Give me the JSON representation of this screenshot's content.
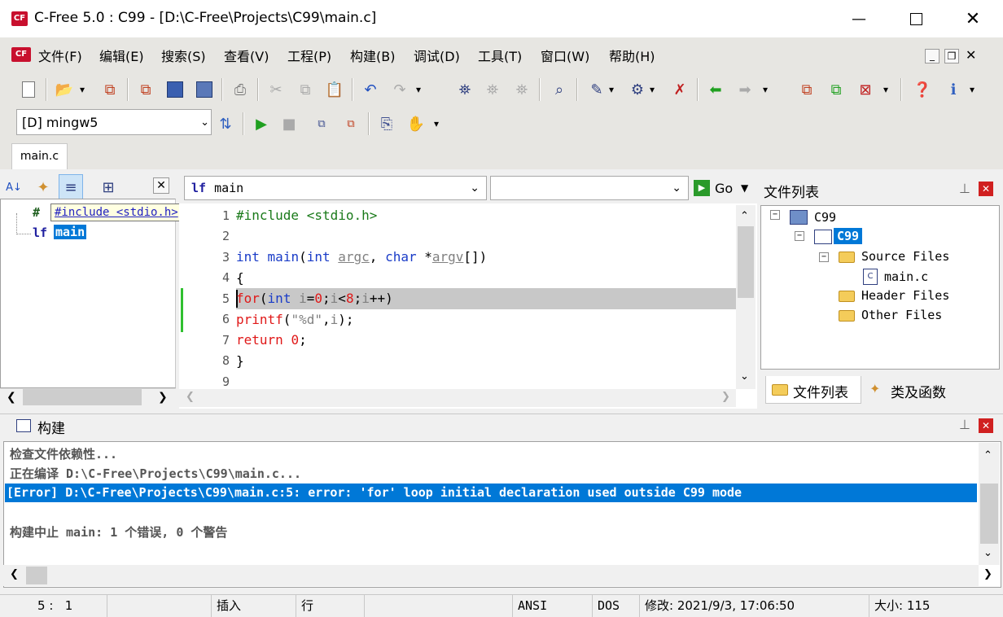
{
  "window": {
    "title": "C-Free 5.0 : C99 - [D:\\C-Free\\Projects\\C99\\main.c]",
    "app_icon": "CF"
  },
  "menu": {
    "items": [
      "文件(F)",
      "编辑(E)",
      "搜索(S)",
      "查看(V)",
      "工程(P)",
      "构建(B)",
      "调试(D)",
      "工具(T)",
      "窗口(W)",
      "帮助(H)"
    ]
  },
  "compiler": {
    "selected": "[D] mingw5"
  },
  "tabs": {
    "active": "main.c"
  },
  "symbols": {
    "include": "#include <stdio.h>",
    "main": "main",
    "include_glyph": "#",
    "func_glyph": "lf"
  },
  "editor": {
    "function_combo": "main",
    "go_label": "Go",
    "lines": [
      "1",
      "2",
      "3",
      "4",
      "5",
      "6",
      "7",
      "8",
      "9"
    ]
  },
  "filelist": {
    "title": "文件列表",
    "root": "C99",
    "project": "C99",
    "source": "Source Files",
    "file": "main.c",
    "header": "Header Files",
    "other": "Other Files",
    "tab1": "文件列表",
    "tab2": "类及函数"
  },
  "build": {
    "title": "构建",
    "l1": "检查文件依赖性...",
    "l2": "正在编译 D:\\C-Free\\Projects\\C99\\main.c...",
    "l3": "[Error] D:\\C-Free\\Projects\\C99\\main.c:5: error: 'for' loop initial declaration used outside C99 mode",
    "l4": "构建中止 main: 1 个错误, 0 个警告"
  },
  "status": {
    "line": "5",
    "col": "1",
    "mode": "插入",
    "unit": "行",
    "encoding": "ANSI",
    "eol": "DOS",
    "modified": "修改: 2021/9/3, 17:06:50",
    "size": "大小: 115"
  },
  "colors": {
    "accent": "#0078d7",
    "keyword": "#1a3cc8",
    "error_red": "#e01818",
    "app_red": "#c8102e"
  }
}
